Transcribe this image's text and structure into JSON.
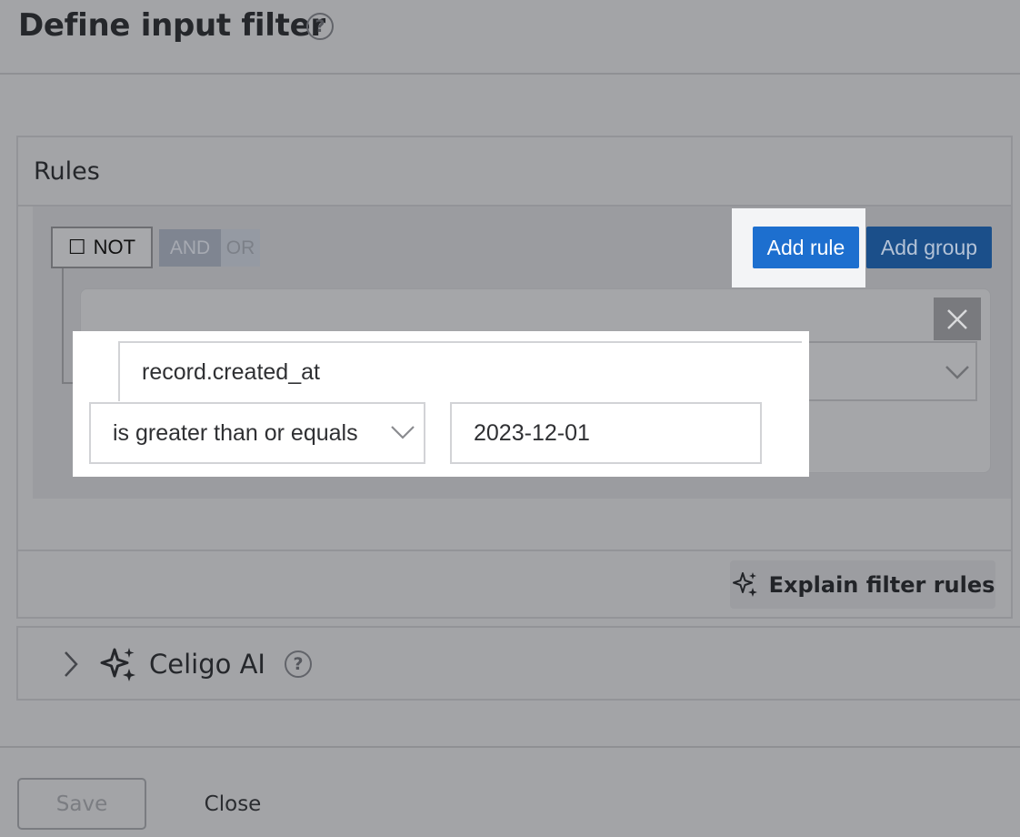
{
  "dialog": {
    "title": "Define input filter",
    "help_glyph": "?"
  },
  "rules": {
    "heading": "Rules",
    "not_label": "NOT",
    "checkbox_glyph": "☐",
    "and_label": "AND",
    "or_label": "OR",
    "add_rule_label": "Add rule",
    "add_group_label": "Add group",
    "rule": {
      "field": "record.created_at",
      "operator": "is greater than or equals",
      "value": "2023-12-01"
    },
    "explain_label": "Explain filter rules"
  },
  "celigo_ai": {
    "label": "Celigo AI",
    "help_glyph": "?"
  },
  "footer": {
    "save_label": "Save",
    "close_label": "Close"
  },
  "colors": {
    "primary_blue": "#1d6fcf",
    "overlay_gray": "#a3a4a7"
  },
  "icons": [
    "help-icon",
    "close-icon",
    "chevron-down-icon",
    "sparkle-icon",
    "chevron-right-icon"
  ]
}
